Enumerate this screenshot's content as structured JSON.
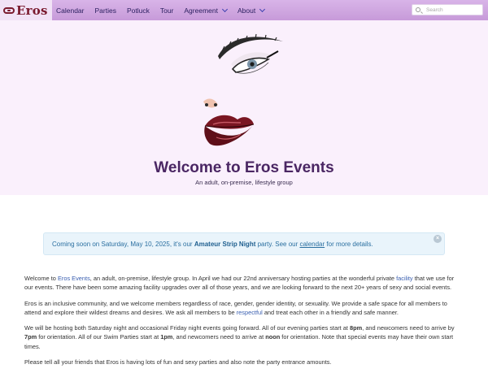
{
  "brand": {
    "name": "Eros"
  },
  "nav": {
    "items": [
      {
        "label": "Calendar",
        "dropdown": false
      },
      {
        "label": "Parties",
        "dropdown": false
      },
      {
        "label": "Potluck",
        "dropdown": false
      },
      {
        "label": "Tour",
        "dropdown": false
      },
      {
        "label": "Agreement",
        "dropdown": true
      },
      {
        "label": "About",
        "dropdown": true
      }
    ]
  },
  "search": {
    "placeholder": "Search"
  },
  "hero": {
    "title": "Welcome to Eros Events",
    "subtitle": "An adult, on-premise, lifestyle group"
  },
  "alert": {
    "prefix": "Coming soon on Saturday, May 10, 2025, it's our ",
    "event": "Amateur Strip Night",
    "middle": " party. See our ",
    "link": "calendar",
    "suffix": " for more details."
  },
  "content": {
    "p1": {
      "a": "Welcome to ",
      "link1": "Eros Events",
      "b": ", an adult, on-premise, lifestyle group. In April we had our 22nd anniversary hosting parties at the wonderful private ",
      "link2": "facility",
      "c": " that we use for our events. There have been some amazing facility upgrades over all of those years, and we are looking forward to the next 20+ years of sexy and social events."
    },
    "p2": {
      "a": "Eros is an inclusive community, and we welcome members regardless of race, gender, gender identity, or sexuality. We provide a safe space for all members to attend and explore their wildest dreams and desires. We ask all members to be ",
      "link": "respectful",
      "b": " and treat each other in a friendly and safe manner."
    },
    "p3": {
      "a": "We will be hosting both Saturday night and occasional Friday night events going forward. All of our evening parties start at ",
      "t1": "8pm",
      "b": ", and newcomers need to arrive by ",
      "t2": "7pm",
      "c": " for orientation. All of our Swim Parties start at ",
      "t3": "1pm",
      "d": ", and newcomers need to arrive at ",
      "t4": "noon",
      "e": " for orientation. Note that special events may have their own start times."
    },
    "p4": "Please tell all your friends that Eros is having lots of fun and sexy parties and also note the party entrance amounts."
  },
  "colors": {
    "navbar": "#c79ad9",
    "brand": "#7a1a2e",
    "hero_bg": "#faf0fc",
    "title": "#4a2663",
    "alert_bg": "#e9f4fb",
    "link": "#3a5fb0"
  }
}
